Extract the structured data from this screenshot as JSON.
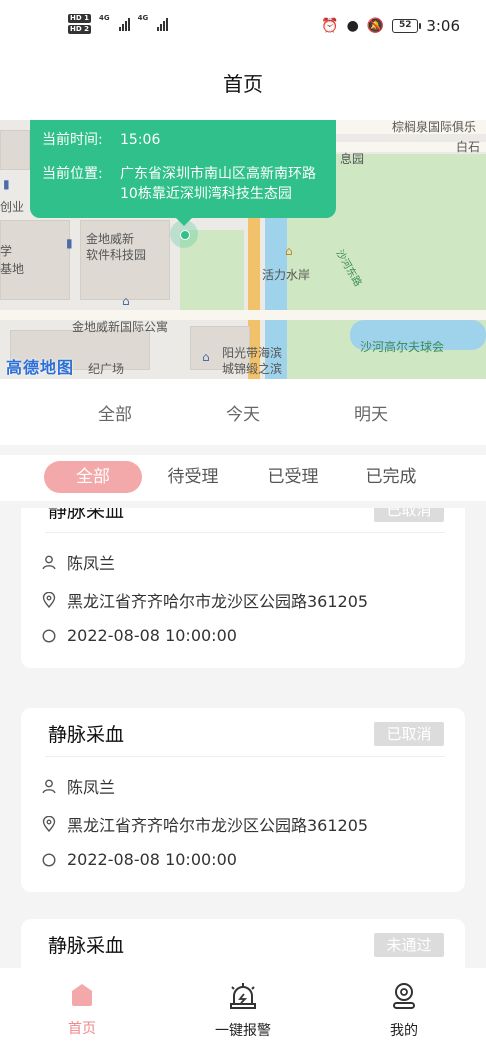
{
  "status_bar": {
    "sim1": "HD 1",
    "sim2": "HD 2",
    "net1": "4G",
    "net2": "4G",
    "battery": "52",
    "time": "3:06",
    "icons": [
      "alarm-icon",
      "location-icon",
      "mute-icon"
    ]
  },
  "header": {
    "title": "首页"
  },
  "map": {
    "popup": {
      "time_label": "当前时间:",
      "time_value": "15:06",
      "location_label": "当前位置:",
      "location_value": "广东省深圳市南山区高新南环路10栋靠近深圳湾科技生态园"
    },
    "labels": {
      "l1": "棕榈泉国际俱乐",
      "l2": "白石",
      "l3": "息园",
      "l4": "创业",
      "l5": "学",
      "l6": "基地",
      "l7": "金地威新",
      "l8": "软件科技园",
      "l9": "活力水岸",
      "l10": "金地威新国际公寓",
      "l11": "阳光带海滨",
      "l12": "城锦缎之滨",
      "l13": "沙河高尔夫球会",
      "l14": "纪广场",
      "l15": "沙河东路"
    },
    "logo": "高德地图"
  },
  "date_tabs": [
    "全部",
    "今天",
    "明天"
  ],
  "status_tabs": [
    "全部",
    "待受理",
    "已受理",
    "已完成"
  ],
  "orders": [
    {
      "title": "静脉采血",
      "status": "已取消",
      "name": "陈凤兰",
      "address": "黑龙江省齐齐哈尔市龙沙区公园路361205",
      "time": "2022-08-08 10:00:00"
    },
    {
      "title": "静脉采血",
      "status": "已取消",
      "name": "陈凤兰",
      "address": "黑龙江省齐齐哈尔市龙沙区公园路361205",
      "time": "2022-08-08 10:00:00"
    },
    {
      "title": "静脉采血",
      "status": "未通过",
      "name": "",
      "address": "",
      "time": ""
    }
  ],
  "bottom_nav": [
    {
      "label": "首页",
      "icon": "home-icon",
      "active": true
    },
    {
      "label": "一键报警",
      "icon": "alarm-siren-icon",
      "active": false
    },
    {
      "label": "我的",
      "icon": "profile-icon",
      "active": false
    }
  ],
  "colors": {
    "accent": "#2fc08c",
    "tab_active": "#f3a9a9",
    "nav_active": "#ee8a8a",
    "badge": "#dcdcdc"
  }
}
